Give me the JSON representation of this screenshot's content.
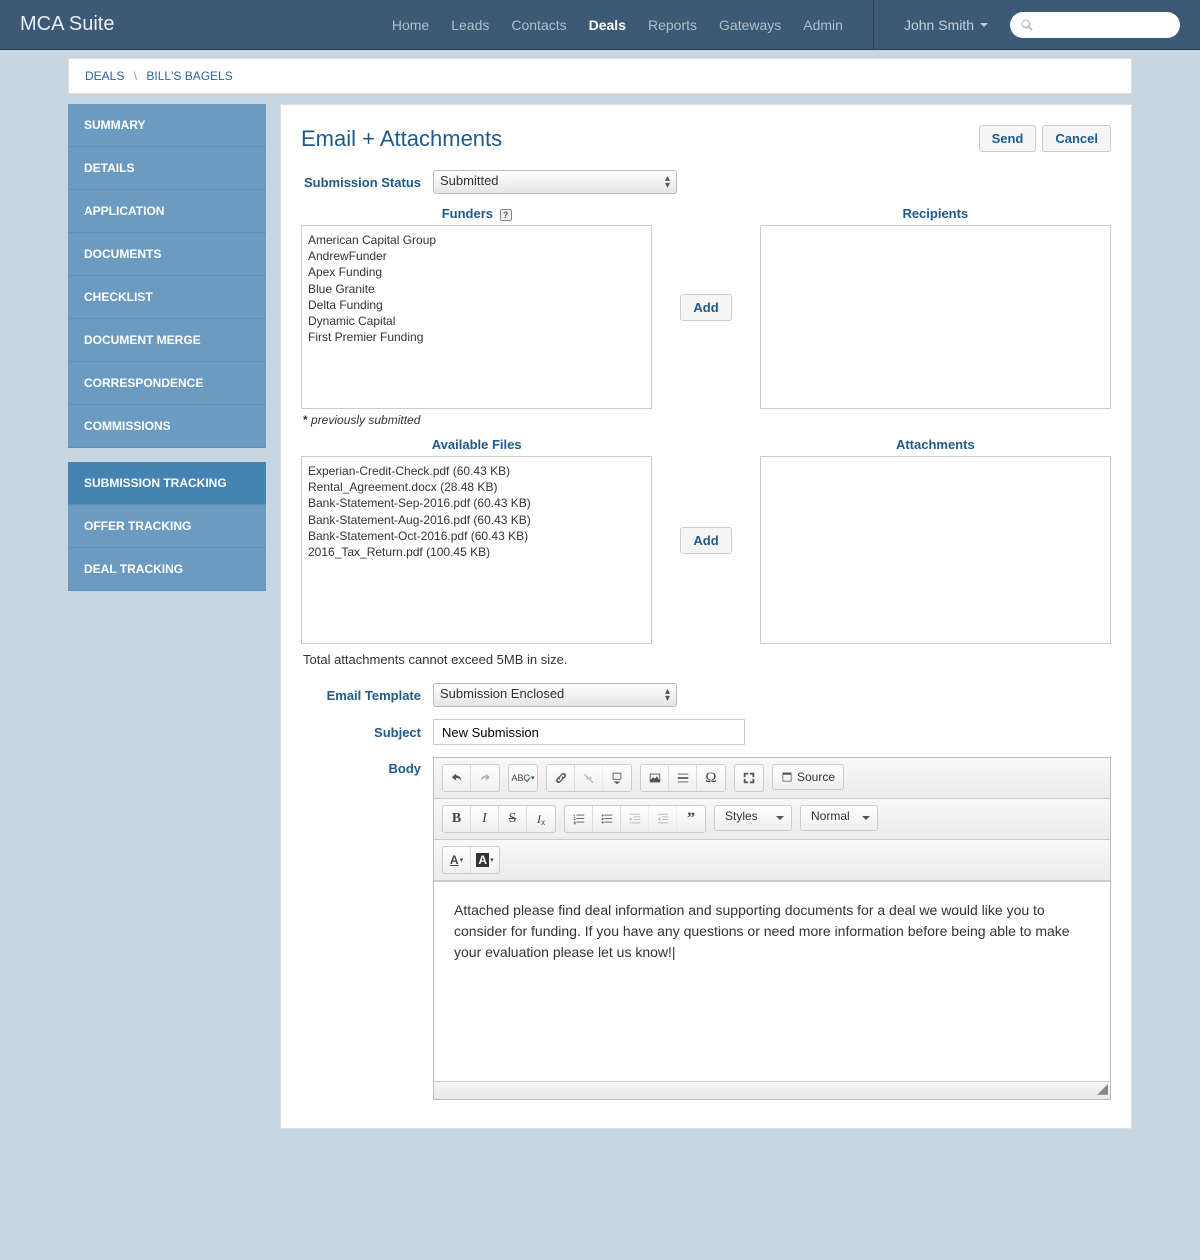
{
  "brand": "MCA Suite",
  "nav": {
    "home": "Home",
    "leads": "Leads",
    "contacts": "Contacts",
    "deals": "Deals",
    "reports": "Reports",
    "gateways": "Gateways",
    "admin": "Admin"
  },
  "user": "John Smith",
  "breadcrumb": {
    "deals": "DEALS",
    "current": "BILL'S BAGELS"
  },
  "sidebar": {
    "items": [
      {
        "label": "SUMMARY"
      },
      {
        "label": "DETAILS"
      },
      {
        "label": "APPLICATION"
      },
      {
        "label": "DOCUMENTS"
      },
      {
        "label": "CHECKLIST"
      },
      {
        "label": "DOCUMENT MERGE"
      },
      {
        "label": "CORRESPONDENCE"
      },
      {
        "label": "COMMISSIONS"
      }
    ],
    "items2": [
      {
        "label": "SUBMISSION TRACKING"
      },
      {
        "label": "OFFER TRACKING"
      },
      {
        "label": "DEAL TRACKING"
      }
    ]
  },
  "page": {
    "title": "Email + Attachments",
    "send": "Send",
    "cancel": "Cancel",
    "status_label": "Submission Status",
    "status_value": "Submitted",
    "funders_label": "Funders",
    "recipients_label": "Recipients",
    "add": "Add",
    "funders": [
      "American Capital Group",
      "AndrewFunder",
      "Apex Funding",
      "Blue Granite",
      "Delta Funding",
      "Dynamic Capital",
      "First Premier Funding"
    ],
    "prev_submitted": "previously submitted",
    "files_label": "Available Files",
    "attachments_label": "Attachments",
    "files": [
      "Experian-Credit-Check.pdf (60.43 KB)",
      "Rental_Agreement.docx (28.48 KB)",
      "Bank-Statement-Sep-2016.pdf (60.43 KB)",
      "Bank-Statement-Aug-2016.pdf (60.43 KB)",
      "Bank-Statement-Oct-2016.pdf (60.43 KB)",
      "2016_Tax_Return.pdf (100.45 KB)"
    ],
    "limit_note": "Total attachments cannot exceed 5MB in size.",
    "template_label": "Email Template",
    "template_value": "Submission Enclosed",
    "subject_label": "Subject",
    "subject_value": "New Submission",
    "body_label": "Body",
    "body_text": "Attached please find deal information and supporting documents for a deal we would like you to consider for funding. If you have any questions or need more information before being able to make your evaluation please let us know!",
    "toolbar": {
      "styles": "Styles",
      "format": "Normal",
      "source": "Source"
    }
  }
}
